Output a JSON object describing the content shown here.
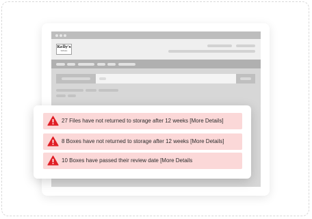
{
  "brand": {
    "logo_name": "Kelly's",
    "logo_tagline": "Software"
  },
  "alerts": [
    {
      "icon": "warning-triangle-icon",
      "text": "27 Files have not returned to storage after 12 weeks [More Details]"
    },
    {
      "icon": "warning-triangle-icon",
      "text": "8 Boxes have not returned to storage after 12 weeks [More Details]"
    },
    {
      "icon": "warning-triangle-icon",
      "text": "10 Boxes have passed their review date [More Details"
    }
  ],
  "colors": {
    "alert_background": "#fbd8d8",
    "warning_red": "#e01e25",
    "browser_gray": "#d7d7d7"
  }
}
